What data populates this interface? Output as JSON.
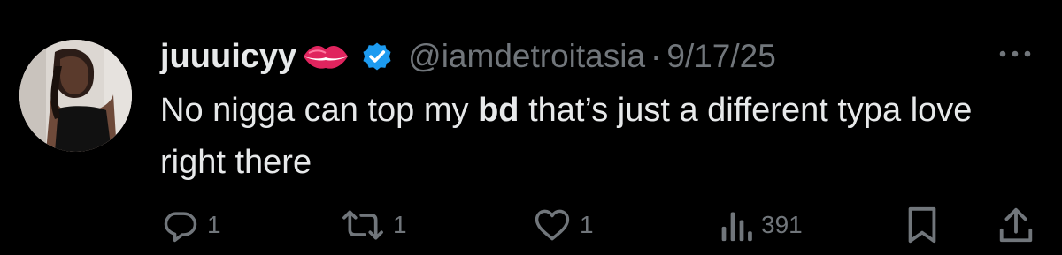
{
  "tweet": {
    "display_name": "juuuicyy",
    "handle": "@iamdetroitasia",
    "separator": "·",
    "date": "9/17/25",
    "text_part1": "No nigga can top my ",
    "text_bold": "bd",
    "text_part2": " that’s just a different typa love right there"
  },
  "icons": {
    "name_emoji": "lips-icon",
    "verified": "verified-badge-icon",
    "more": "more-options-icon",
    "reply": "reply-icon",
    "retweet": "retweet-icon",
    "like": "heart-icon",
    "views": "views-icon",
    "bookmark": "bookmark-icon",
    "share": "share-icon"
  },
  "actions": {
    "reply_count": "1",
    "retweet_count": "1",
    "like_count": "1",
    "view_count": "391"
  },
  "colors": {
    "background": "#000000",
    "primary_text": "#e7e9ea",
    "secondary_text": "#71767b",
    "verified_blue": "#1d9bf0",
    "lips_red": "#e0245e"
  }
}
